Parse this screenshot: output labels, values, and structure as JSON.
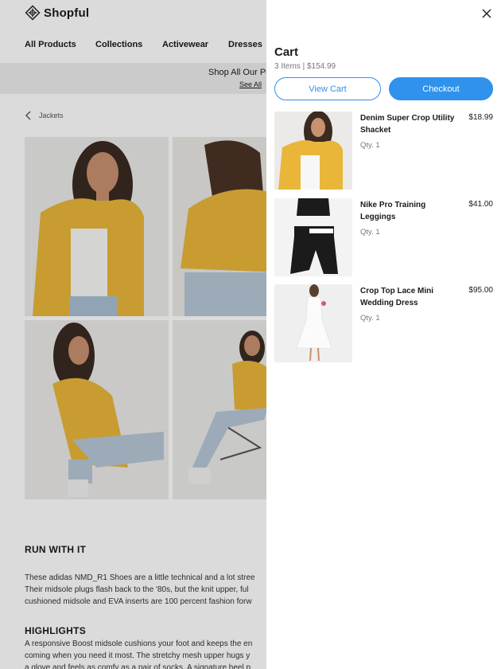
{
  "brand": {
    "name": "Shopful"
  },
  "nav": [
    "All Products",
    "Collections",
    "Activewear",
    "Dresses"
  ],
  "promo": {
    "text": "Shop All Our Pr",
    "link": "See All"
  },
  "breadcrumb": {
    "label": "Jackets"
  },
  "description": {
    "run_title": "RUN WITH IT",
    "run_lines": [
      "These adidas NMD_R1 Shoes are a little technical and a lot stree",
      "Their midsole plugs flash back to the '80s, but the knit upper, ful",
      "cushioned midsole and EVA inserts are 100 percent fashion forw"
    ],
    "highlights_title": "HIGHLIGHTS",
    "highlights_lines": [
      "A responsive Boost midsole cushions your foot and keeps the en",
      "coming when you need it most. The stretchy mesh upper hugs y",
      "a glove and feels as comfy as a pair of socks. A signature heel p"
    ]
  },
  "cart": {
    "title": "Cart",
    "summary": "3 Items | $154.99",
    "view_cart_label": "View Cart",
    "checkout_label": "Checkout",
    "items": [
      {
        "name": "Denim Super Crop Utility Shacket",
        "qty": "Qty. 1",
        "price": "$18.99"
      },
      {
        "name": "Nike Pro Training Leggings",
        "qty": "Qty. 1",
        "price": "$41.00"
      },
      {
        "name": "Crop Top Lace Mini Wedding Dress",
        "qty": "Qty. 1",
        "price": "$95.00"
      }
    ]
  },
  "icons": {
    "logo": "diamond-logo-icon",
    "breadcrumb": "chevron-left-icon",
    "close": "close-icon"
  },
  "colors": {
    "accent": "#2f92ec",
    "jacket": "#e9b63a",
    "promo_bg": "#ededed"
  }
}
